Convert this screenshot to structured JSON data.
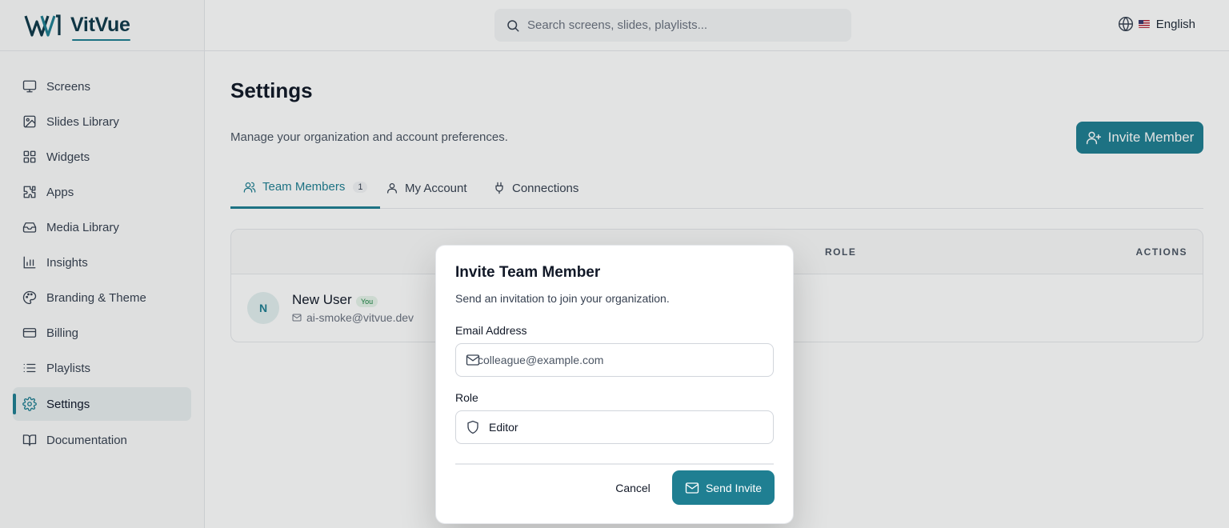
{
  "brand": {
    "name": "VitVue",
    "logo_icon": "vitvue-logo-mark"
  },
  "search": {
    "placeholder": "Search screens, slides, playlists...",
    "icon": "search-icon"
  },
  "language": {
    "label": "English",
    "icon": "globe-icon",
    "flag": "us-flag"
  },
  "sidebar": {
    "items": [
      {
        "label": "Screens",
        "icon": "monitor-icon",
        "active": false
      },
      {
        "label": "Slides Library",
        "icon": "image-icon",
        "active": false
      },
      {
        "label": "Widgets",
        "icon": "grid-icon",
        "active": false
      },
      {
        "label": "Apps",
        "icon": "puzzle-icon",
        "active": false
      },
      {
        "label": "Media Library",
        "icon": "inbox-icon",
        "active": false
      },
      {
        "label": "Insights",
        "icon": "bar-chart-icon",
        "active": false
      },
      {
        "label": "Branding & Theme",
        "icon": "palette-icon",
        "active": false
      },
      {
        "label": "Billing",
        "icon": "credit-card-icon",
        "active": false
      },
      {
        "label": "Playlists",
        "icon": "list-icon",
        "active": false
      },
      {
        "label": "Settings",
        "icon": "gear-icon",
        "active": true
      },
      {
        "label": "Documentation",
        "icon": "book-icon",
        "active": false
      }
    ]
  },
  "page": {
    "title": "Settings",
    "subtitle": "Manage your organization and account preferences.",
    "invite_button": "Invite Member"
  },
  "tabs": [
    {
      "label": "Team Members",
      "count": "1",
      "icon": "users-icon",
      "active": true
    },
    {
      "label": "My Account",
      "icon": "user-icon",
      "active": false
    },
    {
      "label": "Connections",
      "icon": "plug-icon",
      "active": false
    }
  ],
  "table": {
    "headers": {
      "role": "ROLE",
      "actions": "ACTIONS"
    },
    "rows": [
      {
        "initial": "N",
        "name": "New User",
        "badge": "You",
        "email": "ai-smoke@vitvue.dev"
      }
    ]
  },
  "modal": {
    "title": "Invite Team Member",
    "description": "Send an invitation to join your organization.",
    "email_label": "Email Address",
    "email_placeholder": "colleague@example.com",
    "role_label": "Role",
    "role_value": "Editor",
    "cancel": "Cancel",
    "send": "Send Invite"
  },
  "colors": {
    "accent": "#1f7f92",
    "brand_dark": "#0f3a4a"
  }
}
